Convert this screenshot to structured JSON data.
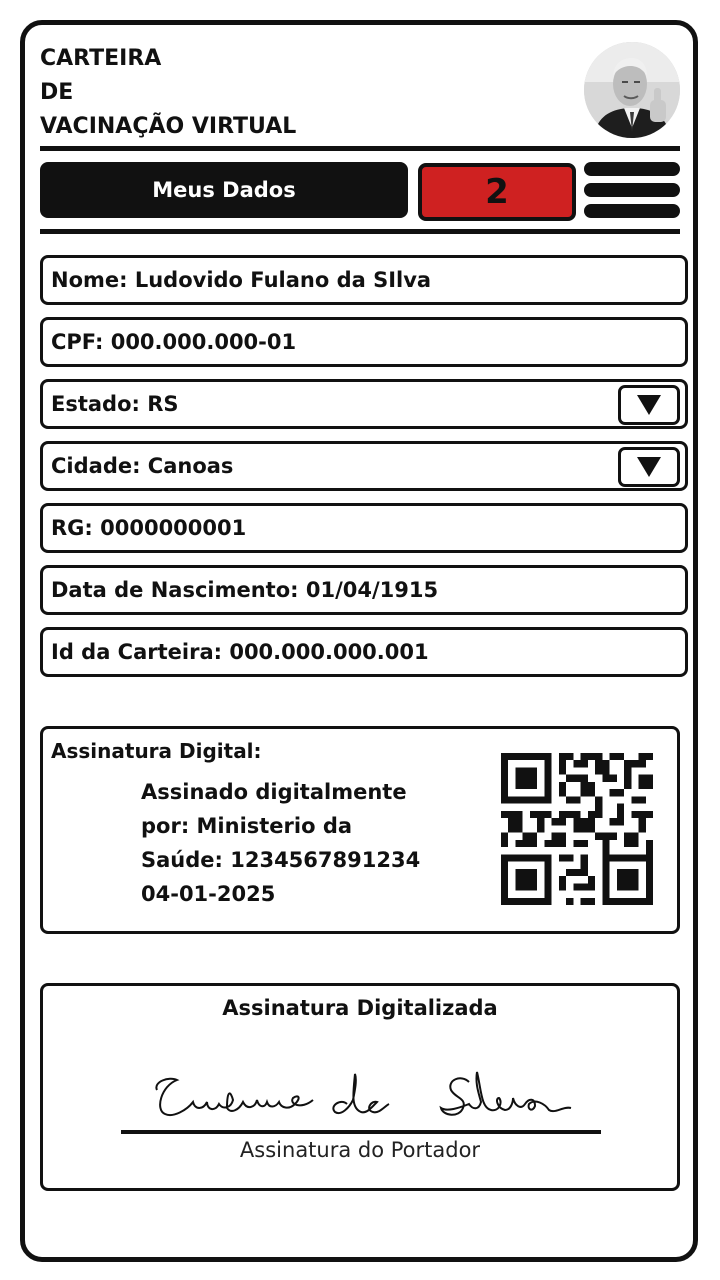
{
  "header": {
    "title_lines": [
      "CARTEIRA",
      "DE",
      "VACINAÇÃO VIRTUAL"
    ]
  },
  "nav": {
    "tab_label": "Meus Dados",
    "badge_count": "2"
  },
  "fields": {
    "nome": "Nome: Ludovido Fulano da SIlva",
    "cpf": "CPF: 000.000.000-01",
    "estado": "Estado: RS",
    "cidade": "Cidade: Canoas",
    "rg": "RG: 0000000001",
    "nascimento": "Data de Nascimento: 01/04/1915",
    "id_carteira": "Id da Carteira: 000.000.000.001"
  },
  "digital_signature": {
    "title": "Assinatura Digital:",
    "lines": [
      "Assinado digitalmente",
      "por: Ministerio da",
      "Saúde: 1234567891234",
      "04-01-2025"
    ]
  },
  "scanned_signature": {
    "title": "Assinatura Digitalizada",
    "handwriting": "Ludovico da Silva",
    "caption": "Assinatura do Portador"
  },
  "colors": {
    "accent_red": "#cf2121",
    "ink": "#111111",
    "background": "#ffffff"
  },
  "icons": {
    "dropdown": "triangle-down-icon",
    "menu": "hamburger-menu-icon"
  }
}
